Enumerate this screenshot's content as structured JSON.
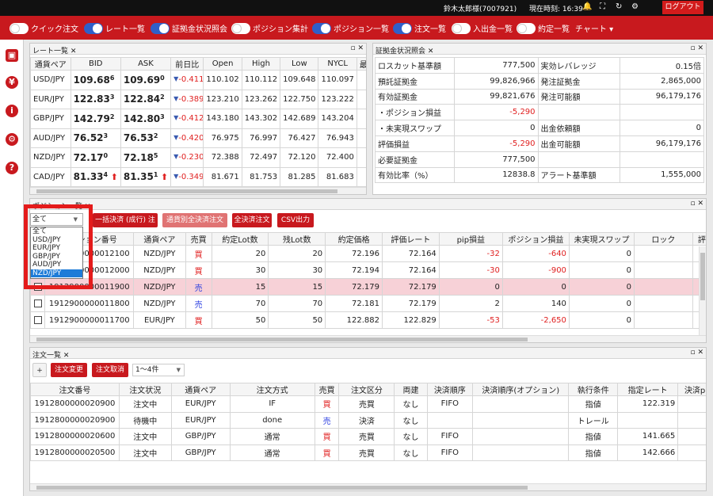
{
  "topbar": {
    "user": "鈴木太郎様(7007921)",
    "time_label": "現在時刻: 16:39",
    "logout": "ログアウト"
  },
  "toolbar": {
    "items": [
      {
        "label": "クイック注文",
        "on": false
      },
      {
        "label": "レート一覧",
        "on": true
      },
      {
        "label": "証拠金状況照会",
        "on": true
      },
      {
        "label": "ポジション集計",
        "on": false
      },
      {
        "label": "ポジション一覧",
        "on": true
      },
      {
        "label": "注文一覧",
        "on": true
      },
      {
        "label": "入出金一覧",
        "on": false
      },
      {
        "label": "約定一覧",
        "on": false
      }
    ],
    "chart_label": "チャート ▾"
  },
  "rate_panel": {
    "title": "レート一覧",
    "headers": [
      "通貨ペア",
      "BID",
      "ASK",
      "前日比",
      "Open",
      "High",
      "Low",
      "NYCL",
      "最終"
    ],
    "rows": [
      {
        "pair": "USD/JPY",
        "bid_main": "109.68",
        "bid_sup": "6",
        "ask_main": "109.69",
        "ask_sup": "0",
        "diff": "-0.411",
        "open": "110.102",
        "high": "110.112",
        "low": "109.648",
        "nycl": "110.097",
        "arrow": false
      },
      {
        "pair": "EUR/JPY",
        "bid_main": "122.83",
        "bid_sup": "3",
        "ask_main": "122.84",
        "ask_sup": "2",
        "diff": "-0.389",
        "open": "123.210",
        "high": "123.262",
        "low": "122.750",
        "nycl": "123.222",
        "arrow": false
      },
      {
        "pair": "GBP/JPY",
        "bid_main": "142.79",
        "bid_sup": "2",
        "ask_main": "142.80",
        "ask_sup": "3",
        "diff": "-0.412",
        "open": "143.180",
        "high": "143.302",
        "low": "142.689",
        "nycl": "143.204",
        "arrow": false
      },
      {
        "pair": "AUD/JPY",
        "bid_main": "76.52",
        "bid_sup": "3",
        "ask_main": "76.53",
        "ask_sup": "2",
        "diff": "-0.420",
        "open": "76.975",
        "high": "76.997",
        "low": "76.427",
        "nycl": "76.943",
        "arrow": false
      },
      {
        "pair": "NZD/JPY",
        "bid_main": "72.17",
        "bid_sup": "0",
        "ask_main": "72.18",
        "ask_sup": "5",
        "diff": "-0.230",
        "open": "72.388",
        "high": "72.497",
        "low": "72.120",
        "nycl": "72.400",
        "arrow": false
      },
      {
        "pair": "CAD/JPY",
        "bid_main": "81.33",
        "bid_sup": "4",
        "ask_main": "81.35",
        "ask_sup": "1",
        "diff": "-0.349",
        "open": "81.671",
        "high": "81.753",
        "low": "81.285",
        "nycl": "81.683",
        "arrow": true
      }
    ]
  },
  "margin_panel": {
    "title": "証拠金状況照会",
    "rows": [
      {
        "l1": "ロスカット基準額",
        "v1": "777,500",
        "l2": "実効レバレッジ",
        "v2": "0.15倍",
        "neg1": false
      },
      {
        "l1": "預託証拠金",
        "v1": "99,826,966",
        "l2": "発注証拠金",
        "v2": "2,865,000",
        "neg1": false
      },
      {
        "l1": "有効証拠金",
        "v1": "99,821,676",
        "l2": "発注可能額",
        "v2": "96,179,176",
        "neg1": false
      },
      {
        "l1": "・ポジション損益",
        "v1": "-5,290",
        "l2": "",
        "v2": "",
        "neg1": true
      },
      {
        "l1": "・未実現スワップ",
        "v1": "0",
        "l2": "出金依頼額",
        "v2": "0",
        "neg1": false
      },
      {
        "l1": "評価損益",
        "v1": "-5,290",
        "l2": "出金可能額",
        "v2": "96,179,176",
        "neg1": true
      },
      {
        "l1": "必要証拠金",
        "v1": "777,500",
        "l2": "",
        "v2": "",
        "neg1": false
      },
      {
        "l1": "有効比率（%）",
        "v1": "12838.8",
        "l2": "アラート基準額",
        "v2": "1,555,000",
        "neg1": false
      }
    ]
  },
  "position_panel": {
    "title": "ポジション一覧",
    "buttons": [
      "一括決済 (成行) 注文",
      "通貨別全決済注文",
      "全決済注文",
      "CSV出力"
    ],
    "filter_value": "全て",
    "filter_options": [
      "全て",
      "USD/JPY",
      "EUR/JPY",
      "GBP/JPY",
      "AUD/JPY",
      "NZD/JPY"
    ],
    "filter_selected": "NZD/JPY",
    "headers": [
      "",
      "ポジション番号",
      "通貨ペア",
      "売買",
      "約定Lot数",
      "残Lot数",
      "約定価格",
      "評価レート",
      "pip損益",
      "ポジション損益",
      "未実現スワップ",
      "ロック",
      "評価損"
    ],
    "rows": [
      {
        "no": "1912900000012100",
        "pair": "NZD/JPY",
        "side": "買",
        "lot": "20",
        "rem": "20",
        "price": "72.196",
        "rate": "72.164",
        "pip": "-32",
        "pl": "-640",
        "swap": "0",
        "hl": false
      },
      {
        "no": "1912900000012000",
        "pair": "NZD/JPY",
        "side": "買",
        "lot": "30",
        "rem": "30",
        "price": "72.194",
        "rate": "72.164",
        "pip": "-30",
        "pl": "-900",
        "swap": "0",
        "hl": false
      },
      {
        "no": "1912900000011900",
        "pair": "NZD/JPY",
        "side": "売",
        "lot": "15",
        "rem": "15",
        "price": "72.179",
        "rate": "72.179",
        "pip": "0",
        "pl": "0",
        "swap": "0",
        "hl": true
      },
      {
        "no": "1912900000011800",
        "pair": "NZD/JPY",
        "side": "売",
        "lot": "70",
        "rem": "70",
        "price": "72.181",
        "rate": "72.179",
        "pip": "2",
        "pl": "140",
        "swap": "0",
        "hl": false
      },
      {
        "no": "1912900000011700",
        "pair": "EUR/JPY",
        "side": "買",
        "lot": "50",
        "rem": "50",
        "price": "122.882",
        "rate": "122.829",
        "pip": "-53",
        "pl": "-2,650",
        "swap": "0",
        "hl": false
      }
    ]
  },
  "order_panel": {
    "title": "注文一覧",
    "plus": "+",
    "buttons": [
      "注文変更",
      "注文取消"
    ],
    "count_value": "1～4件",
    "headers": [
      "注文番号",
      "注文状況",
      "通貨ペア",
      "注文方式",
      "売買",
      "注文区分",
      "両建",
      "決済順序",
      "決済順序(オプション)",
      "執行条件",
      "指定レート",
      "決済pip差"
    ],
    "rows": [
      {
        "no": "1912800000020900",
        "status": "注文中",
        "pair": "EUR/JPY",
        "method": "IF",
        "side": "買",
        "type": "売買",
        "both": "なし",
        "order": "FIFO",
        "opt": "",
        "cond": "指値",
        "rate": "122.319"
      },
      {
        "no": "1912800000020900",
        "status": "待機中",
        "pair": "EUR/JPY",
        "method": "done",
        "side": "売",
        "type": "決済",
        "both": "なし",
        "order": "",
        "opt": "",
        "cond": "トレール",
        "rate": ""
      },
      {
        "no": "1912800000020600",
        "status": "注文中",
        "pair": "GBP/JPY",
        "method": "通常",
        "side": "買",
        "type": "売買",
        "both": "なし",
        "order": "FIFO",
        "opt": "",
        "cond": "指値",
        "rate": "141.665"
      },
      {
        "no": "1912800000020500",
        "status": "注文中",
        "pair": "GBP/JPY",
        "method": "通常",
        "side": "買",
        "type": "売買",
        "both": "なし",
        "order": "FIFO",
        "opt": "",
        "cond": "指値",
        "rate": "142.666"
      }
    ]
  },
  "colors": {
    "brand_red": "#c8191e",
    "toggle_on": "#2f5fc9",
    "negative": "#e02020",
    "sell_blue": "#2c3fe0"
  },
  "icons": {
    "sidebar": [
      "save-icon",
      "yen-icon",
      "info-icon",
      "gear-icon",
      "help-icon"
    ]
  }
}
